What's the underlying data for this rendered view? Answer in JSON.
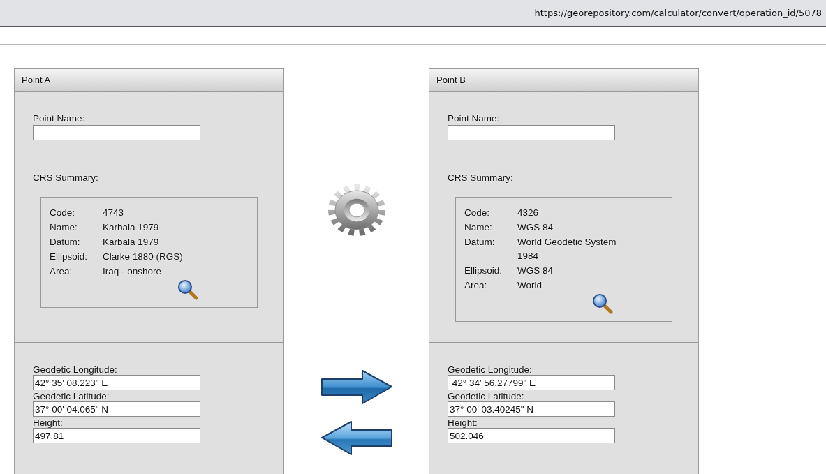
{
  "address_bar": {
    "url": "https://georepository.com/calculator/convert/operation_id/5078"
  },
  "panels": [
    {
      "title": "Point A",
      "point_name": {
        "label": "Point Name:"
      },
      "crs_summary": {
        "label": "CRS Summary:",
        "rows": [
          {
            "key": "Code:",
            "value": "4743"
          },
          {
            "key": "Name:",
            "value": "Karbala 1979"
          },
          {
            "key": "Datum:",
            "value": "Karbala 1979"
          },
          {
            "key": "Ellipsoid:",
            "value": "Clarke 1880 (RGS)"
          },
          {
            "key": "Area:",
            "value": "Iraq - onshore"
          }
        ]
      },
      "coordinates": [
        {
          "label": "Geodetic Longitude:",
          "value": "42° 35' 08.223\" E"
        },
        {
          "label": "Geodetic Latitude:",
          "value": "37° 00' 04.065\" N"
        },
        {
          "label": "Height:",
          "value": "497.81"
        }
      ]
    },
    {
      "title": "Point B",
      "point_name": {
        "label": "Point Name:"
      },
      "crs_summary": {
        "label": "CRS Summary:",
        "rows": [
          {
            "key": "Code:",
            "value": "4326"
          },
          {
            "key": "Name:",
            "value": "WGS 84"
          },
          {
            "key": "Datum:",
            "value": "World Geodetic System 1984"
          },
          {
            "key": "Ellipsoid:",
            "value": "WGS 84"
          },
          {
            "key": "Area:",
            "value": "World"
          }
        ]
      },
      "coordinates": [
        {
          "label": "Geodetic Longitude:",
          "value": " 42° 34' 56.27799\" E"
        },
        {
          "label": "Geodetic Latitude:",
          "value": "37° 00' 03.40245\" N"
        },
        {
          "label": "Height:",
          "value": "502.046"
        }
      ]
    }
  ]
}
